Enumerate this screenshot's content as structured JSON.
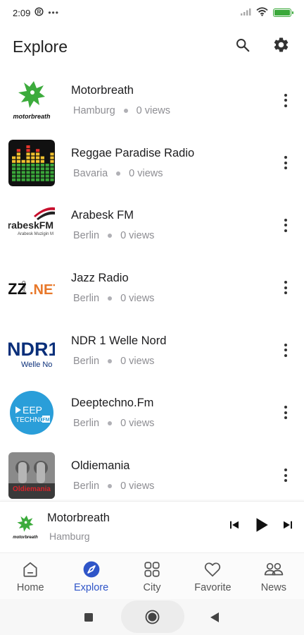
{
  "status_bar": {
    "time": "2:09",
    "battery_level": 1.0,
    "colors": {
      "battery": "#3aa83a"
    }
  },
  "header": {
    "title": "Explore",
    "icons": [
      "search-icon",
      "settings-icon"
    ]
  },
  "stations": [
    {
      "name": "Motorbreath",
      "city": "Hamburg",
      "views": "0 views",
      "logo": "motorbreath-logo",
      "logo_text": "motorbreath"
    },
    {
      "name": "Reggae Paradise Radio",
      "city": "Bavaria",
      "views": "0 views",
      "logo": "equalizer-logo"
    },
    {
      "name": "Arabesk FM",
      "city": "Berlin",
      "views": "0 views",
      "logo": "arabesk-logo",
      "logo_text": "urabeskFM",
      "logo_subtext": "Arabesk Muzigin M"
    },
    {
      "name": "Jazz Radio",
      "city": "Berlin",
      "views": "0 views",
      "logo": "jazz-radio-logo",
      "logo_text": "ZZ",
      "logo_small": "RADIO",
      "logo_suffix": ".NET"
    },
    {
      "name": "NDR 1 Welle Nord",
      "city": "Berlin",
      "views": "0 views",
      "logo": "ndr-logo",
      "logo_text": "NDR1",
      "logo_subtext": "Welle No"
    },
    {
      "name": "Deeptechno.Fm",
      "city": "Berlin",
      "views": "0 views",
      "logo": "deeptechno-logo",
      "logo_text": "EEP",
      "logo_subtext": "TECHNO",
      "logo_badge": "FM"
    },
    {
      "name": "Oldiemania",
      "city": "Berlin",
      "views": "0 views",
      "logo": "oldiemania-logo",
      "logo_text": "Oldiemania"
    }
  ],
  "mini_player": {
    "title": "Motorbreath",
    "subtitle": "Hamburg",
    "logo_text": "motorbreath",
    "controls": [
      "skip-previous-icon",
      "play-icon",
      "skip-next-icon"
    ]
  },
  "bottom_nav": [
    {
      "label": "Home",
      "icon": "home-icon",
      "active": false
    },
    {
      "label": "Explore",
      "icon": "compass-icon",
      "active": true
    },
    {
      "label": "City",
      "icon": "grid-icon",
      "active": false
    },
    {
      "label": "Favorite",
      "icon": "heart-icon",
      "active": false
    },
    {
      "label": "News",
      "icon": "people-icon",
      "active": false
    }
  ],
  "colors": {
    "accent": "#2f55c8",
    "text_primary": "#1c1c1e",
    "text_secondary": "#8e8e93"
  }
}
